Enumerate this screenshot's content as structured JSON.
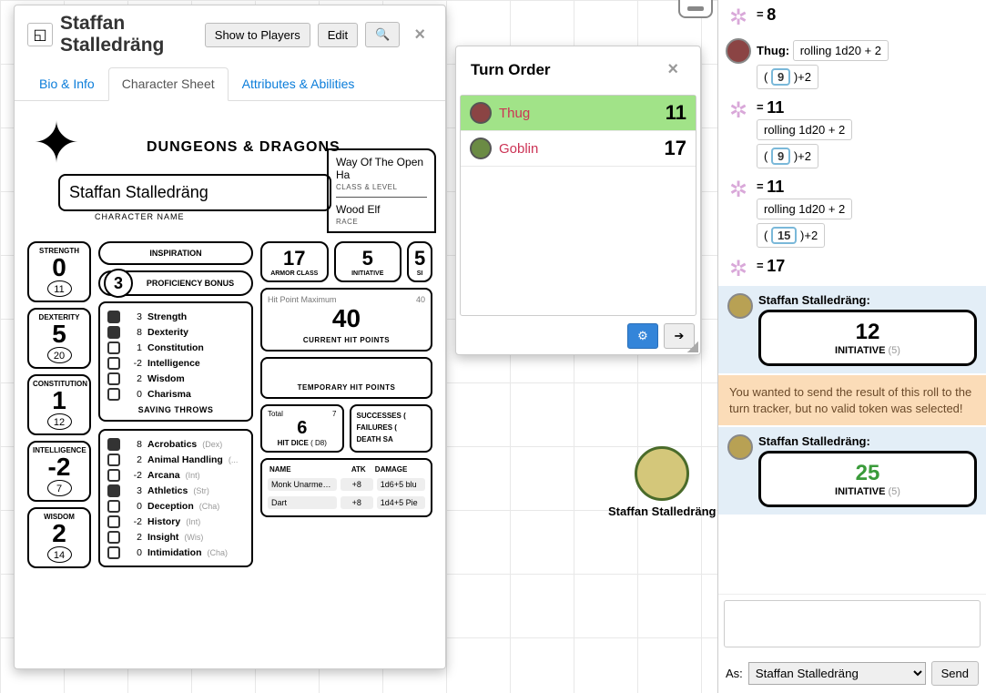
{
  "dialog": {
    "title": "Staffan Stalledräng",
    "show": "Show to Players",
    "edit": "Edit",
    "tabs": [
      "Bio & Info",
      "Character Sheet",
      "Attributes & Abilities"
    ],
    "active_tab": 1
  },
  "sheet": {
    "brand": "DUNGEONS & DRAGONS",
    "char_name": "Staffan Stalledräng",
    "char_name_label": "CHARACTER NAME",
    "class": "Way Of The Open Ha",
    "class_label": "CLASS & LEVEL",
    "race": "Wood Elf",
    "race_label": "RACE",
    "inspiration": "INSPIRATION",
    "prof": "PROFICIENCY BONUS",
    "prof_v": "3",
    "abilities": [
      {
        "name": "STRENGTH",
        "mod": "0",
        "score": "11"
      },
      {
        "name": "DEXTERITY",
        "mod": "5",
        "score": "20"
      },
      {
        "name": "CONSTITUTION",
        "mod": "1",
        "score": "12"
      },
      {
        "name": "INTELLIGENCE",
        "mod": "-2",
        "score": "7"
      },
      {
        "name": "WISDOM",
        "mod": "2",
        "score": "14"
      }
    ],
    "saves_title": "SAVING THROWS",
    "saves": [
      {
        "p": true,
        "v": "3",
        "n": "Strength"
      },
      {
        "p": true,
        "v": "8",
        "n": "Dexterity"
      },
      {
        "p": false,
        "v": "1",
        "n": "Constitution"
      },
      {
        "p": false,
        "v": "-2",
        "n": "Intelligence"
      },
      {
        "p": false,
        "v": "2",
        "n": "Wisdom"
      },
      {
        "p": false,
        "v": "0",
        "n": "Charisma"
      }
    ],
    "skills": [
      {
        "p": true,
        "v": "8",
        "n": "Acrobatics",
        "a": "(Dex)"
      },
      {
        "p": false,
        "v": "2",
        "n": "Animal Handling",
        "a": "(..."
      },
      {
        "p": false,
        "v": "-2",
        "n": "Arcana",
        "a": "(Int)"
      },
      {
        "p": true,
        "v": "3",
        "n": "Athletics",
        "a": "(Str)"
      },
      {
        "p": false,
        "v": "0",
        "n": "Deception",
        "a": "(Cha)"
      },
      {
        "p": false,
        "v": "-2",
        "n": "History",
        "a": "(Int)"
      },
      {
        "p": false,
        "v": "2",
        "n": "Insight",
        "a": "(Wis)"
      },
      {
        "p": false,
        "v": "0",
        "n": "Intimidation",
        "a": "(Cha)"
      }
    ],
    "ac": "17",
    "ac_l": "ARMOR CLASS",
    "init": "5",
    "init_l": "INITIATIVE",
    "spd": "5",
    "spd_l": "SI",
    "hp_max_l": "Hit Point Maximum",
    "hp_max": "40",
    "hp_cur": "40",
    "hp_cur_l": "CURRENT HIT POINTS",
    "thp_l": "TEMPORARY HIT POINTS",
    "hd_total_l": "Total",
    "hd_total": "7",
    "hd": "6",
    "hd_l": "HIT DICE",
    "hd_d": "( D8)",
    "ds_s": "SUCCESSES (",
    "ds_f": "FAILURES (",
    "ds_l": "DEATH SA",
    "wpn_h": [
      "NAME",
      "ATK",
      "DAMAGE"
    ],
    "wpns": [
      {
        "n": "Monk Unarmed ...",
        "a": "+8",
        "d": "1d6+5 blu"
      },
      {
        "n": "Dart",
        "a": "+8",
        "d": "1d4+5 Pie"
      }
    ]
  },
  "turn": {
    "title": "Turn Order",
    "items": [
      {
        "name": "Thug",
        "val": "11",
        "active": true
      },
      {
        "name": "Goblin",
        "val": "17",
        "active": false
      }
    ],
    "gear": "⚙",
    "next": "➔"
  },
  "map_token": "Staffan Stalledräng",
  "chat": {
    "r1": "8",
    "thug": "Thug:",
    "thug_roll": "rolling 1d20 + 2",
    "d": "9",
    "mod": ")+2",
    "eq": "=",
    "r2": "11",
    "r3_roll": "rolling 1d20 + 2",
    "r3_d": "9",
    "r3": "11",
    "r4_roll": "rolling 1d20 + 2",
    "r4_d": "15",
    "r4": "17",
    "pc": "Staffan Stalledräng:",
    "i1": "12",
    "il": "INITIATIVE",
    "id": "(5)",
    "warn": "You wanted to send the result of this roll to the turn tracker, but no valid token was selected!",
    "i2": "25",
    "as": "As:",
    "speaker": "Staffan Stalledräng",
    "send": "Send"
  }
}
